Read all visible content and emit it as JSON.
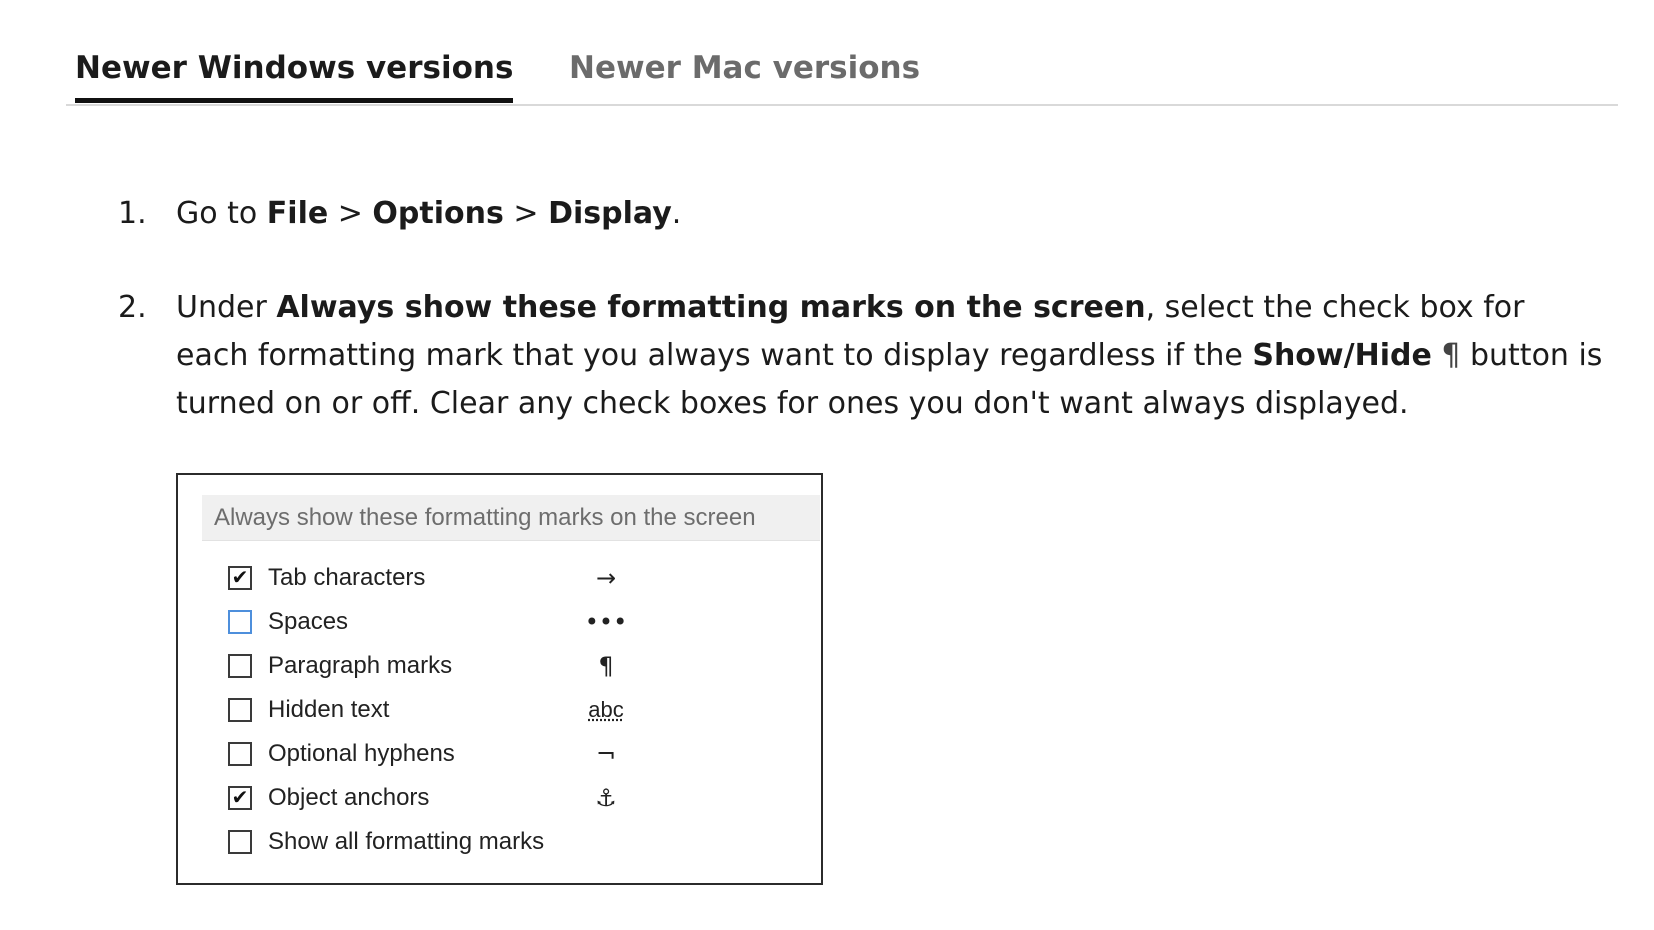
{
  "tabs": [
    {
      "label": "Newer Windows versions",
      "active": true
    },
    {
      "label": "Newer Mac versions",
      "active": false
    }
  ],
  "steps": [
    {
      "number": "1.",
      "parts": [
        "Go to ",
        "File",
        " > ",
        "Options",
        " > ",
        "Display",
        "."
      ]
    },
    {
      "number": "2.",
      "parts": [
        "Under ",
        "Always show these formatting marks on the screen",
        ", select the check box for each formatting mark that you always want to display regardless if the ",
        "Show/Hide",
        "¶",
        " button is turned on or off. Clear any check boxes for ones you don't want always displayed."
      ]
    }
  ],
  "dialog": {
    "header": "Always show these formatting marks on the screen",
    "options": [
      {
        "label": "Tab characters",
        "checked": true,
        "mark": "→"
      },
      {
        "label": "Spaces",
        "checked": false,
        "mark": "•••"
      },
      {
        "label": "Paragraph marks",
        "checked": false,
        "mark": "¶"
      },
      {
        "label": "Hidden text",
        "checked": false,
        "mark": "abc"
      },
      {
        "label": "Optional hyphens",
        "checked": false,
        "mark": "¬"
      },
      {
        "label": "Object anchors",
        "checked": true,
        "mark": "⚓"
      },
      {
        "label": "Show all formatting marks",
        "checked": false,
        "mark": ""
      }
    ],
    "check_glyph": "✔"
  }
}
